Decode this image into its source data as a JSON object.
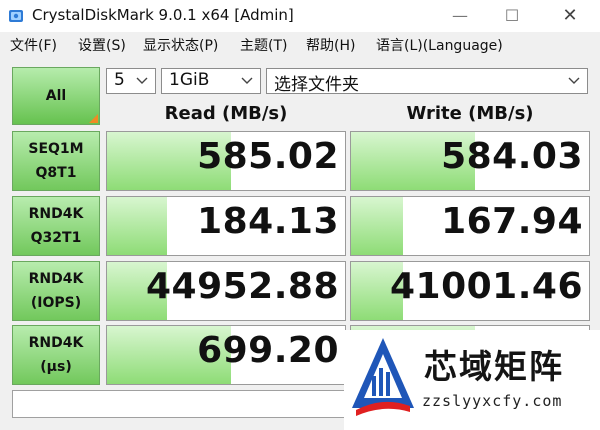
{
  "window": {
    "title": "CrystalDiskMark 9.0.1 x64 [Admin]",
    "min_glyph": "—",
    "max_glyph": "☐",
    "close_glyph": "✕"
  },
  "menu": [
    "文件(F)",
    "设置(S)",
    "显示状态(P)",
    "主题(T)",
    "帮助(H)",
    "语言(L)(Language)"
  ],
  "controls": {
    "all_label": "All",
    "count": "5",
    "size": "1GiB",
    "drive": "选择文件夹"
  },
  "columns": {
    "read": "Read (MB/s)",
    "write": "Write (MB/s)"
  },
  "rows": [
    {
      "line1": "SEQ1M",
      "line2": "Q8T1",
      "read": "585.02",
      "write": "584.03",
      "read_fill": 0.52,
      "write_fill": 0.52
    },
    {
      "line1": "RND4K",
      "line2": "Q32T1",
      "read": "184.13",
      "write": "167.94",
      "read_fill": 0.25,
      "write_fill": 0.22
    },
    {
      "line1": "RND4K",
      "line2": "(IOPS)",
      "read": "44952.88",
      "write": "41001.46",
      "read_fill": 0.25,
      "write_fill": 0.22
    },
    {
      "line1": "RND4K",
      "line2": "(μs)",
      "read": "699.20",
      "write": "",
      "read_fill": 0.52,
      "write_fill": 0.52
    }
  ],
  "comment": "",
  "watermark": {
    "name": "芯域矩阵",
    "url": "zzslyyxcfy.com"
  },
  "colors": {
    "accent_green": "#66c24f",
    "corner_orange": "#f08a24",
    "logo_blue": "#1f56b8",
    "logo_red": "#e02020"
  }
}
